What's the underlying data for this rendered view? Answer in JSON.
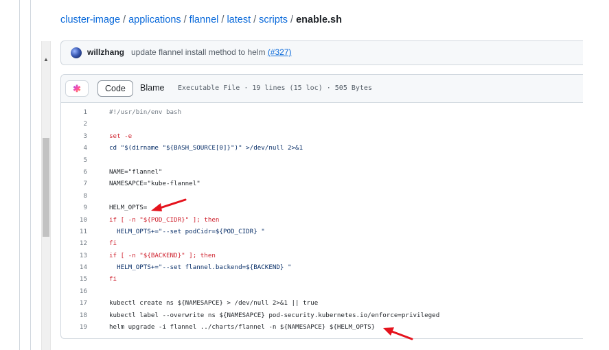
{
  "breadcrumb": {
    "repo": "cluster-image",
    "path": [
      "applications",
      "flannel",
      "latest",
      "scripts"
    ],
    "file": "enable.sh",
    "separator": "/"
  },
  "commit": {
    "author": "willzhang",
    "message": "update flannel install method to helm",
    "pr": "(#327)"
  },
  "file_header": {
    "copilot_icon": "copilot-sparkle-icon",
    "tabs": [
      "Code",
      "Blame"
    ],
    "active_tab": "Code",
    "info": "Executable File · 19 lines (15 loc) · 505 Bytes"
  },
  "code": [
    {
      "n": "1",
      "t": "#!/usr/bin/env bash"
    },
    {
      "n": "2",
      "t": ""
    },
    {
      "n": "3",
      "t": "set -e"
    },
    {
      "n": "4",
      "t": "cd \"$(dirname \"${BASH_SOURCE[0]}\")\" >/dev/null 2>&1"
    },
    {
      "n": "5",
      "t": ""
    },
    {
      "n": "6",
      "t": "NAME=\"flannel\""
    },
    {
      "n": "7",
      "t": "NAMESAPCE=\"kube-flannel\""
    },
    {
      "n": "8",
      "t": ""
    },
    {
      "n": "9",
      "t": "HELM_OPTS="
    },
    {
      "n": "10",
      "t": "if [ -n \"${POD_CIDR}\" ]; then"
    },
    {
      "n": "11",
      "t": "  HELM_OPTS+=\"--set podCidr=${POD_CIDR} \""
    },
    {
      "n": "12",
      "t": "fi"
    },
    {
      "n": "13",
      "t": "if [ -n \"${BACKEND}\" ]; then"
    },
    {
      "n": "14",
      "t": "  HELM_OPTS+=\"--set flannel.backend=${BACKEND} \""
    },
    {
      "n": "15",
      "t": "fi"
    },
    {
      "n": "16",
      "t": ""
    },
    {
      "n": "17",
      "t": "kubectl create ns ${NAMESAPCE} > /dev/null 2>&1 || true"
    },
    {
      "n": "18",
      "t": "kubectl label --overwrite ns ${NAMESAPCE} pod-security.kubernetes.io/enforce=privileged"
    },
    {
      "n": "19",
      "t": "helm upgrade -i flannel ../charts/flannel -n ${NAMESAPCE} ${HELM_OPTS}"
    }
  ],
  "colors": {
    "link": "#0969da",
    "keyword": "#cf222e",
    "string": "#0a3069",
    "annotation_arrow": "#e5131d"
  }
}
